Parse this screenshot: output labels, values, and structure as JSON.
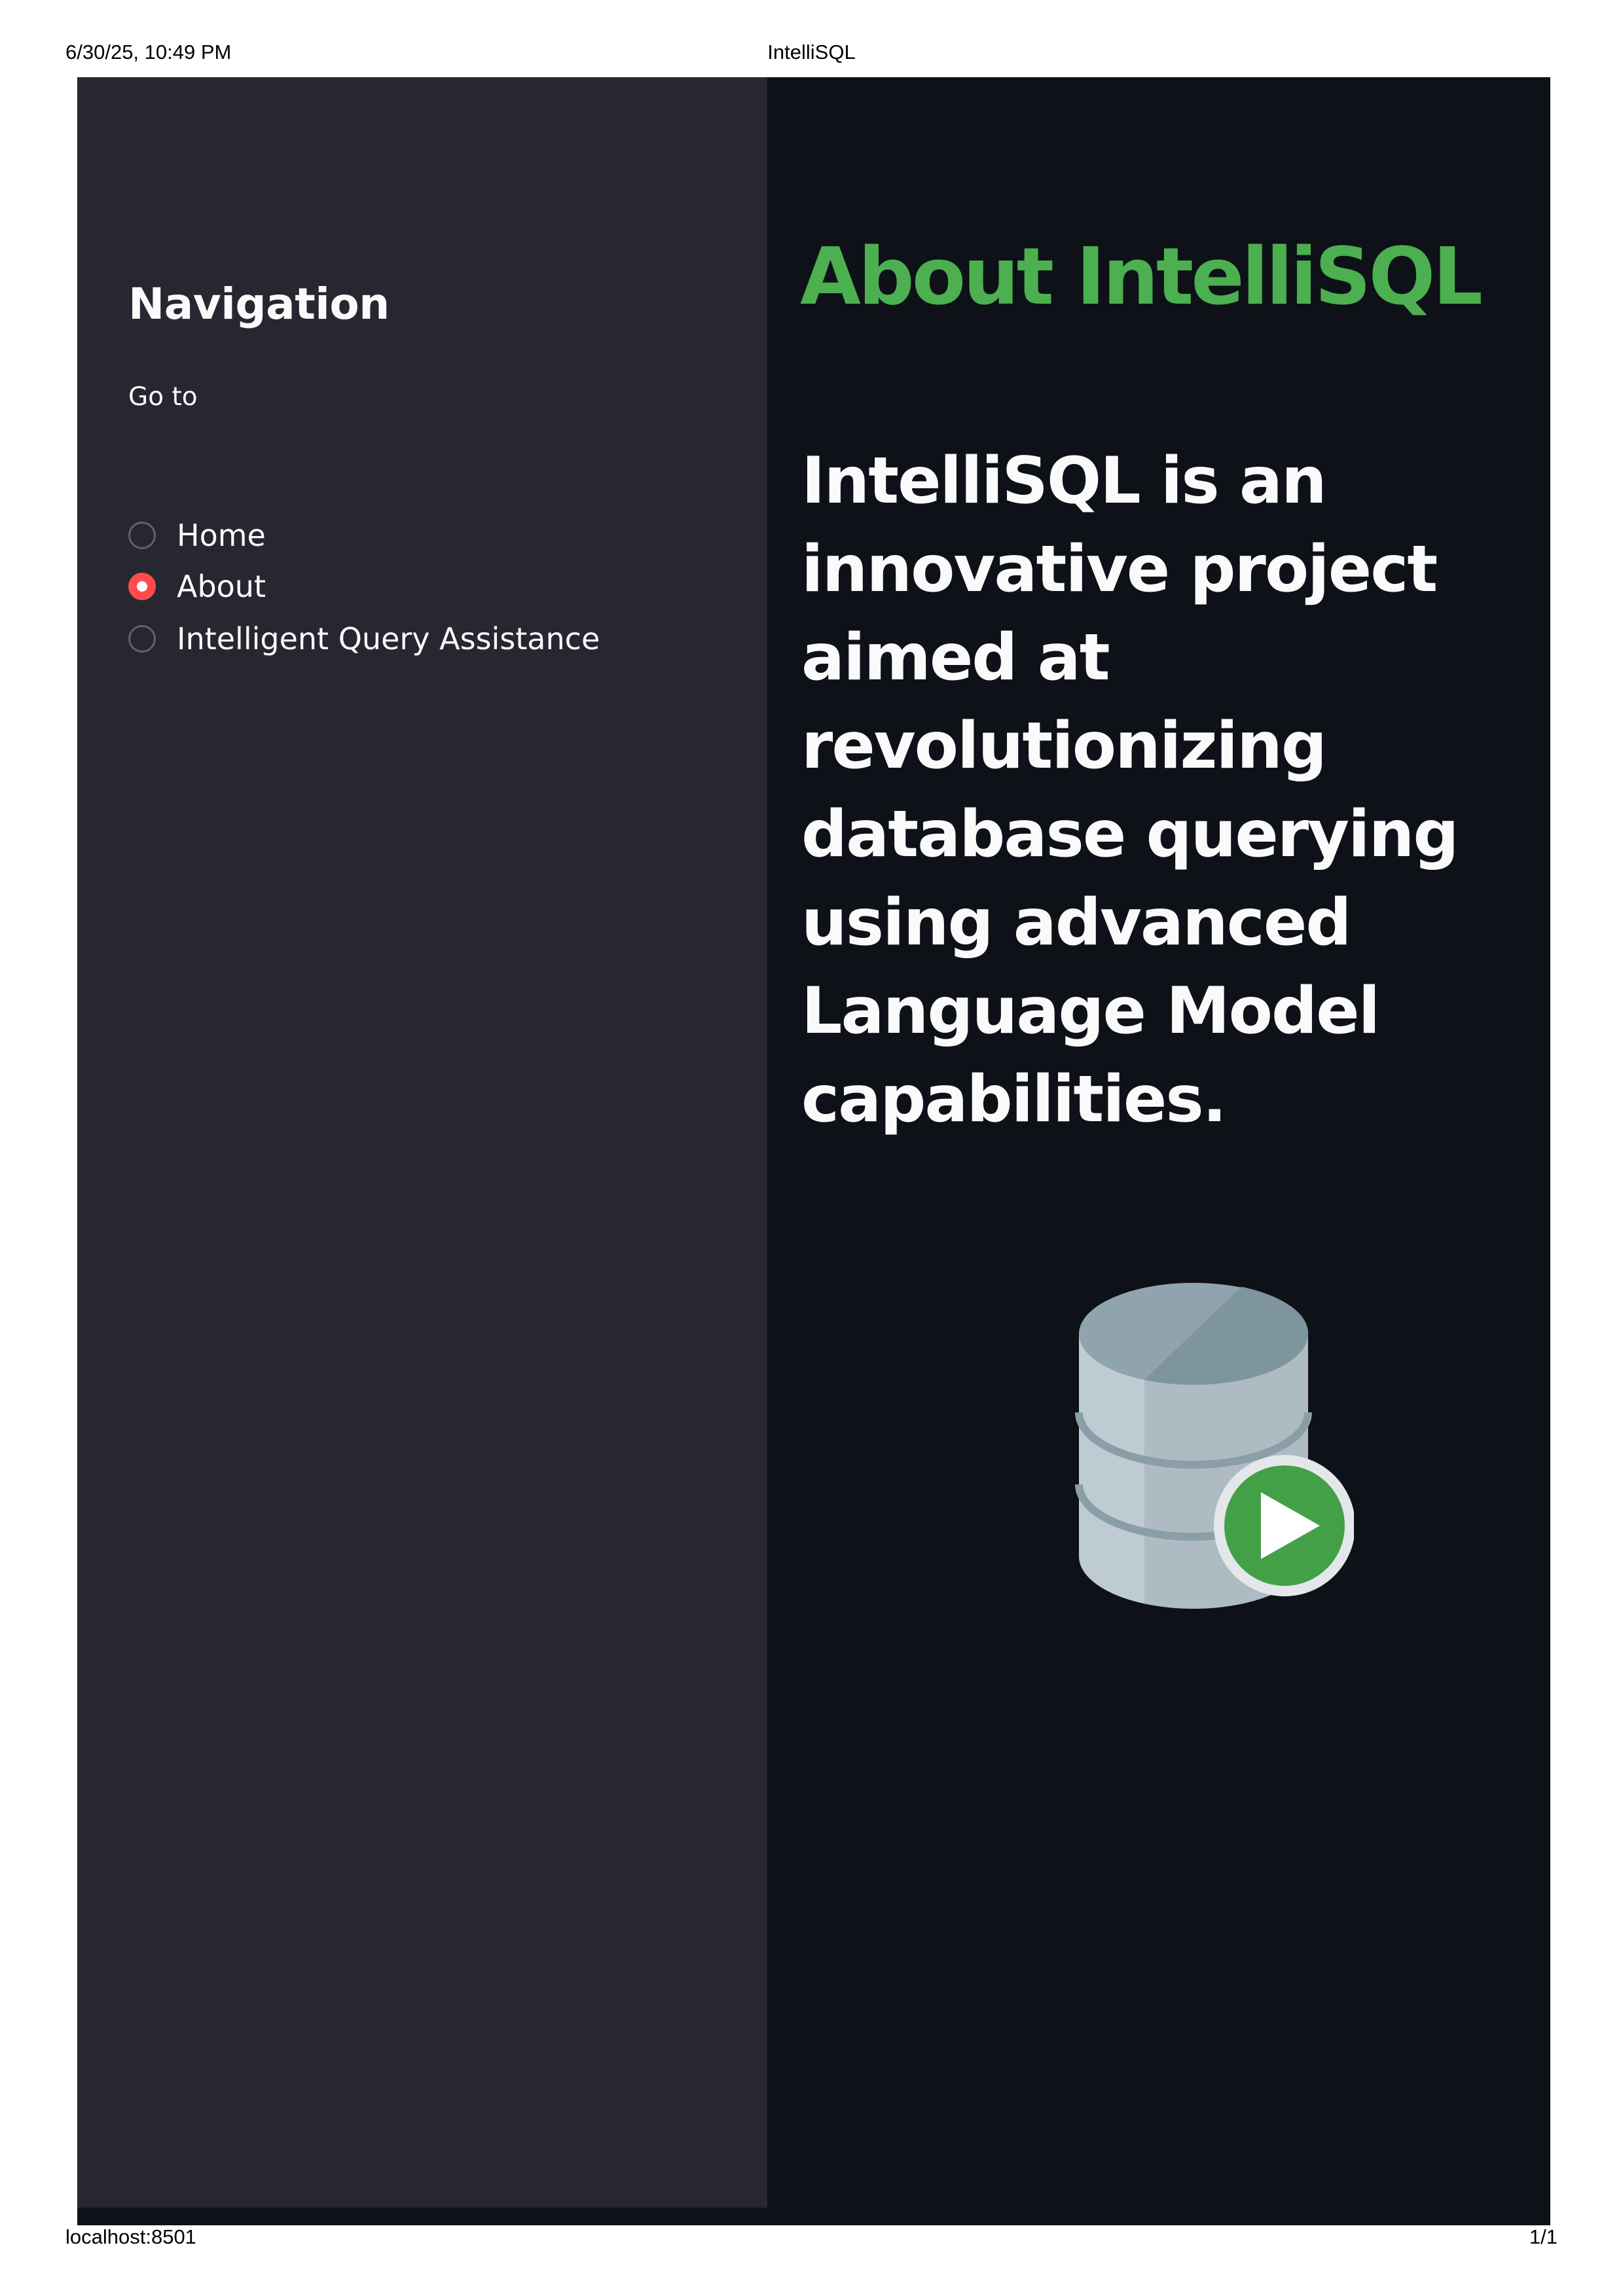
{
  "print": {
    "datetime": "6/30/25, 10:49 PM",
    "page_title": "IntelliSQL",
    "url": "localhost:8501",
    "page_number": "1/1"
  },
  "sidebar": {
    "title": "Navigation",
    "radio_label": "Go to",
    "options": [
      {
        "label": "Home",
        "selected": false
      },
      {
        "label": "About",
        "selected": true
      },
      {
        "label": "Intelligent Query Assistance",
        "selected": false
      }
    ]
  },
  "main": {
    "title": "About IntelliSQL",
    "description": "IntelliSQL is an innovative project aimed at revolutionizing database querying using advanced Language Model capabilities.",
    "image_icon": "database-play-icon"
  },
  "colors": {
    "sidebar_bg": "#262730",
    "main_bg": "#0e1117",
    "title_accent": "#4caf50",
    "radio_selected": "#ff4b4b",
    "text": "#fafafa"
  }
}
